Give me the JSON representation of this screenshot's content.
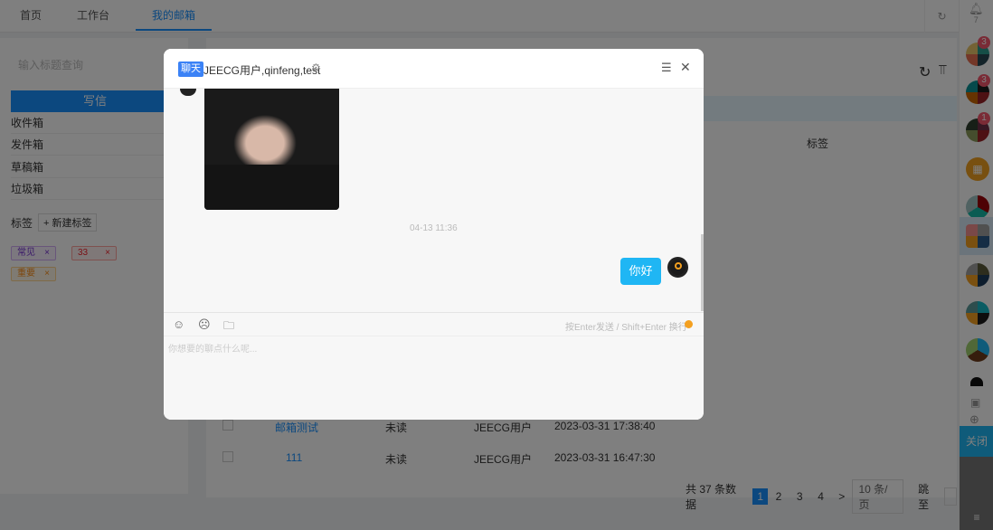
{
  "nav": {
    "tabs": [
      "首页",
      "工作台",
      "我的邮箱"
    ],
    "active": 2
  },
  "left": {
    "search_placeholder": "输入标题查询",
    "write_label": "写信",
    "boxes": [
      {
        "label": "收件箱",
        "color": "#fa8c16"
      },
      {
        "label": "发件箱",
        "color": "#fa8c16"
      },
      {
        "label": "草稿箱",
        "color": "#f5222d"
      },
      {
        "label": "垃圾箱",
        "color": "#f5222d"
      }
    ],
    "tags_label": "标签",
    "new_tag_label": "+ 新建标签",
    "tags": [
      {
        "label": "常见",
        "color": "#722ed1"
      },
      {
        "label": "33",
        "color": "#f5222d"
      },
      {
        "label": "重要",
        "color": "#fa8c16"
      }
    ]
  },
  "main": {
    "column_tag": "标签",
    "rows": [
      {
        "title": "邮箱测试",
        "status": "未读",
        "sender": "JEECG用户",
        "time": "2023-03-31 17:38:40"
      },
      {
        "title": "111",
        "status": "未读",
        "sender": "JEECG用户",
        "time": "2023-03-31 16:47:30"
      }
    ],
    "pagination": {
      "total": "共 37 条数据",
      "pages": [
        "1",
        "2",
        "3",
        "4"
      ],
      "current": "1",
      "next": ">",
      "page_size": "10 条/页",
      "jump": "跳至"
    }
  },
  "rail": {
    "bell_count": "7",
    "badges": [
      "3",
      "3",
      "1"
    ],
    "close_label": "关闭"
  },
  "chat": {
    "chip": "聊天",
    "title": "JEECG用户,qinfeng,test",
    "timestamp": "04-13 11:36",
    "message": "你好",
    "hint": "按Enter发送 / Shift+Enter 换行",
    "input_placeholder": "你想要的聊点什么呢...",
    "accent": "#1fb6f4"
  }
}
